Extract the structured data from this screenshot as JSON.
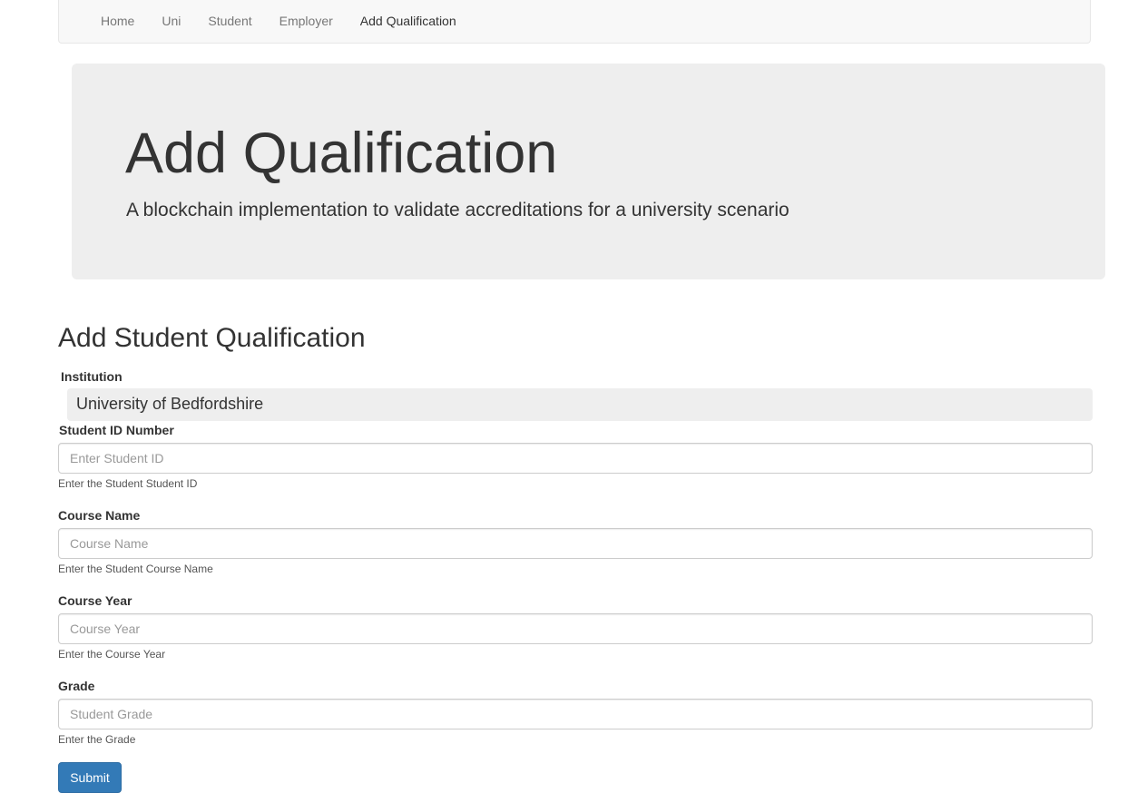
{
  "nav": {
    "items": [
      {
        "label": "Home"
      },
      {
        "label": "Uni"
      },
      {
        "label": "Student"
      },
      {
        "label": "Employer"
      },
      {
        "label": "Add Qualification"
      }
    ]
  },
  "jumbotron": {
    "title": "Add Qualification",
    "lead": "A blockchain implementation to validate accreditations for a university scenario"
  },
  "form": {
    "title": "Add Student Qualification",
    "institution": {
      "label": "Institution",
      "value": "University of Bedfordshire"
    },
    "student_id": {
      "label": "Student ID Number",
      "placeholder": "Enter Student ID",
      "help": "Enter the Student Student ID"
    },
    "course_name": {
      "label": "Course Name",
      "placeholder": "Course Name",
      "help": "Enter the Student Course Name"
    },
    "course_year": {
      "label": "Course Year",
      "placeholder": "Course Year",
      "help": "Enter the Course Year"
    },
    "grade": {
      "label": "Grade",
      "placeholder": "Student Grade",
      "help": "Enter the Grade"
    },
    "submit_label": "Submit"
  },
  "colors": {
    "primary": "#337ab7",
    "jumbotron_bg": "#eeeeee",
    "navbar_bg": "#f8f8f8"
  }
}
